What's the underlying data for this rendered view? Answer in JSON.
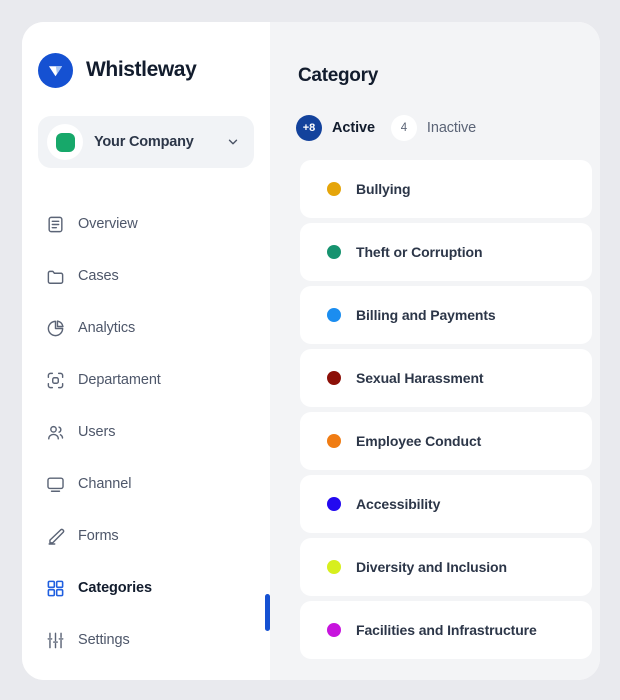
{
  "brand": {
    "name": "Whistleway",
    "logo_icon": "whistle-triangle-logo",
    "logo_color": "#1551d2"
  },
  "company_selector": {
    "name": "Your Company",
    "avatar_color": "#17a86a",
    "chevron_icon": "chevron-down-icon"
  },
  "sidebar": {
    "items": [
      {
        "label": "Overview",
        "icon": "document-list-icon",
        "active": false
      },
      {
        "label": "Cases",
        "icon": "folder-icon",
        "active": false
      },
      {
        "label": "Analytics",
        "icon": "pie-chart-icon",
        "active": false
      },
      {
        "label": "Departament",
        "icon": "scan-box-icon",
        "active": false
      },
      {
        "label": "Users",
        "icon": "users-icon",
        "active": false
      },
      {
        "label": "Channel",
        "icon": "monitor-icon",
        "active": false
      },
      {
        "label": "Forms",
        "icon": "pencil-icon",
        "active": false
      },
      {
        "label": "Categories",
        "icon": "grid-squares-icon",
        "active": true
      },
      {
        "label": "Settings",
        "icon": "sliders-icon",
        "active": false
      }
    ],
    "active_indicator_color": "#1551d2"
  },
  "main": {
    "title": "Category",
    "tabs": [
      {
        "label": "Active",
        "count": "+8",
        "selected": true
      },
      {
        "label": "Inactive",
        "count": "4",
        "selected": false
      }
    ],
    "categories": [
      {
        "label": "Bullying",
        "color": "#e5a50a"
      },
      {
        "label": "Theft or Corruption",
        "color": "#16936f"
      },
      {
        "label": "Billing and Payments",
        "color": "#1b8df0"
      },
      {
        "label": "Sexual Harassment",
        "color": "#8c1008"
      },
      {
        "label": "Employee Conduct",
        "color": "#f07c13"
      },
      {
        "label": "Accessibility",
        "color": "#2309f0"
      },
      {
        "label": "Diversity and Inclusion",
        "color": "#d7ef1e"
      },
      {
        "label": "Facilities and Infrastructure",
        "color": "#c714dd"
      }
    ]
  }
}
